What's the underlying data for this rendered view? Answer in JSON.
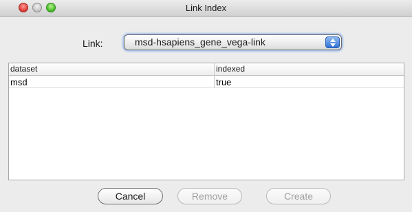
{
  "window": {
    "title": "Link Index"
  },
  "form": {
    "link_label": "Link:",
    "link_value": "msd-hsapiens_gene_vega-link"
  },
  "table": {
    "columns": [
      "dataset",
      "indexed"
    ],
    "rows": [
      [
        "msd",
        "true"
      ]
    ]
  },
  "buttons": {
    "cancel": "Cancel",
    "remove": "Remove",
    "create": "Create"
  },
  "colors": {
    "close": "#e0443e",
    "minimize": "#c9c9c9",
    "zoom": "#4fc132",
    "focus_ring": "#508ce6"
  },
  "icons": {
    "close": "close-dot-icon",
    "minimize": "minimize-dot-icon",
    "zoom": "zoom-dot-icon",
    "select_arrows": "up-down-arrows-icon"
  }
}
